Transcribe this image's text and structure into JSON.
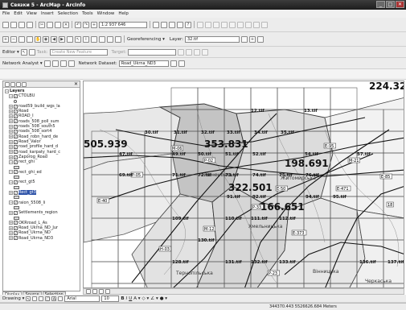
{
  "window": {
    "title": "Связки 5 - ArcMap - ArcInfo"
  },
  "menu": [
    "File",
    "Edit",
    "View",
    "Insert",
    "Selection",
    "Tools",
    "Window",
    "Help"
  ],
  "toolbar1": {
    "scale": "1:2 937 646"
  },
  "toolbar2": {
    "georef_label": "Georeferencing ▾",
    "layer_label": "Layer:",
    "layer_value": "32.tif"
  },
  "toolbar3": {
    "editor_label": "Editor ▾",
    "task_label": "Task:",
    "task_value": "Create New Feature",
    "target_label": "Target:"
  },
  "toolbar4": {
    "network_label": "Network Analyst ▾",
    "dataset_label": "Network Dataset:",
    "dataset_value": "Road_Ukrna_ND3"
  },
  "toc": {
    "items": [
      {
        "t": "Layers",
        "lvl": 0,
        "cb": false,
        "exp": "−",
        "bold": true
      },
      {
        "t": "CTOLBU",
        "lvl": 1,
        "cb": true,
        "exp": "−"
      },
      {
        "t": "",
        "lvl": 2,
        "sym": "o"
      },
      {
        "t": "road59_build_wgs_la",
        "lvl": 1,
        "cb": true,
        "exp": "+"
      },
      {
        "t": "Road",
        "lvl": 1,
        "cb": true,
        "exp": "+"
      },
      {
        "t": "ROAD_I",
        "lvl": 1,
        "cb": true,
        "exp": "+"
      },
      {
        "t": "roads_508_poll_sum",
        "lvl": 1,
        "cb": true,
        "exp": "+"
      },
      {
        "t": "roads_508_south5",
        "lvl": 1,
        "cb": true,
        "exp": "+"
      },
      {
        "t": "roads_508_sort4",
        "lvl": 1,
        "cb": true,
        "exp": "+"
      },
      {
        "t": "Road_robn_hard_de",
        "lvl": 1,
        "cb": true,
        "exp": "+"
      },
      {
        "t": "Road_Valor",
        "lvl": 1,
        "cb": true,
        "exp": "+"
      },
      {
        "t": "road_profile_hard_d",
        "lvl": 1,
        "cb": true,
        "exp": "+"
      },
      {
        "t": "road_karpaty_hard_c",
        "lvl": 1,
        "cb": true,
        "exp": "+"
      },
      {
        "t": "Zaporog_Road",
        "lvl": 1,
        "cb": true,
        "exp": "+"
      },
      {
        "t": "rect_ghi",
        "lvl": 1,
        "cb": true,
        "exp": "−"
      },
      {
        "t": "",
        "lvl": 2,
        "sym": "poly"
      },
      {
        "t": "rect_ghi_ed",
        "lvl": 1,
        "cb": true,
        "exp": "−"
      },
      {
        "t": "",
        "lvl": 2,
        "sym": "poly"
      },
      {
        "t": "rect_gt5",
        "lvl": 1,
        "cb": true,
        "exp": "−"
      },
      {
        "t": "",
        "lvl": 2,
        "sym": "poly"
      },
      {
        "t": "Rect_gt3",
        "lvl": 1,
        "cb": true,
        "exp": "+",
        "sel": true
      },
      {
        "t": "",
        "lvl": 2,
        "sym": "poly"
      },
      {
        "t": "raion_5508_li",
        "lvl": 1,
        "cb": true,
        "exp": "−"
      },
      {
        "t": "",
        "lvl": 2,
        "sym": "poly"
      },
      {
        "t": "Settlements_region",
        "lvl": 1,
        "cb": true,
        "exp": "+"
      },
      {
        "t": "",
        "lvl": 2,
        "sym": "poly"
      },
      {
        "t": "OKRroad_L_As",
        "lvl": 1,
        "cb": true,
        "exp": "+"
      },
      {
        "t": "Road_Ukrna_ND_Jur",
        "lvl": 1,
        "cb": true,
        "exp": "+"
      },
      {
        "t": "Road_Ukrna_ND",
        "lvl": 1,
        "cb": true,
        "exp": "+"
      },
      {
        "t": "Road_Ukrna_ND3",
        "lvl": 1,
        "cb": true,
        "exp": "+"
      }
    ],
    "tabs": [
      "Display",
      "Source",
      "Selection"
    ]
  },
  "map": {
    "big_labels": [
      "224.326",
      "505.939",
      "353.831",
      "198.691",
      "322.501",
      "166.651"
    ],
    "tiles": [
      "12.tif",
      "13.tif",
      "30.tif",
      "31.tif",
      "32.tif",
      "33.tif",
      "34.tif",
      "35.tif",
      "47.tif",
      "49.tif",
      "50.tif",
      "51.tif",
      "52.tif",
      "54.tif",
      "57.tif",
      "69.tif",
      "71.tif",
      "72.tif",
      "73.tif",
      "74.tif",
      "75.tif",
      "76.tif",
      "91.tif",
      "92.tif",
      "94.tif",
      "95.tif",
      "109.tif",
      "110.tif",
      "111.tif",
      "112.tif",
      "131.tif",
      "132.tif",
      "133.tif",
      "136.tif",
      "137.tif",
      "130.tif",
      "128.tif"
    ],
    "places": [
      "Рівненська",
      "Житомирська",
      "Хмельницька",
      "Вінницька",
      "Черкаська",
      "Тернопільська"
    ],
    "roads": [
      "E-40",
      "M-06",
      "P-05",
      "P-02",
      "E-95",
      "M-21",
      "E-50",
      "M-12",
      "P-33",
      "E-373",
      "H-03",
      "P-23",
      "E-471",
      "E-85",
      "18"
    ]
  },
  "draw": {
    "label": "Drawing ▾",
    "font": "Arial",
    "size": "10"
  },
  "status": {
    "coords": "344370.443 5526626.684 Meters"
  },
  "colors": {
    "titlebar": "#2b2b2b",
    "selection": "#2d52a8",
    "region_fill": "#c4c4c4"
  }
}
